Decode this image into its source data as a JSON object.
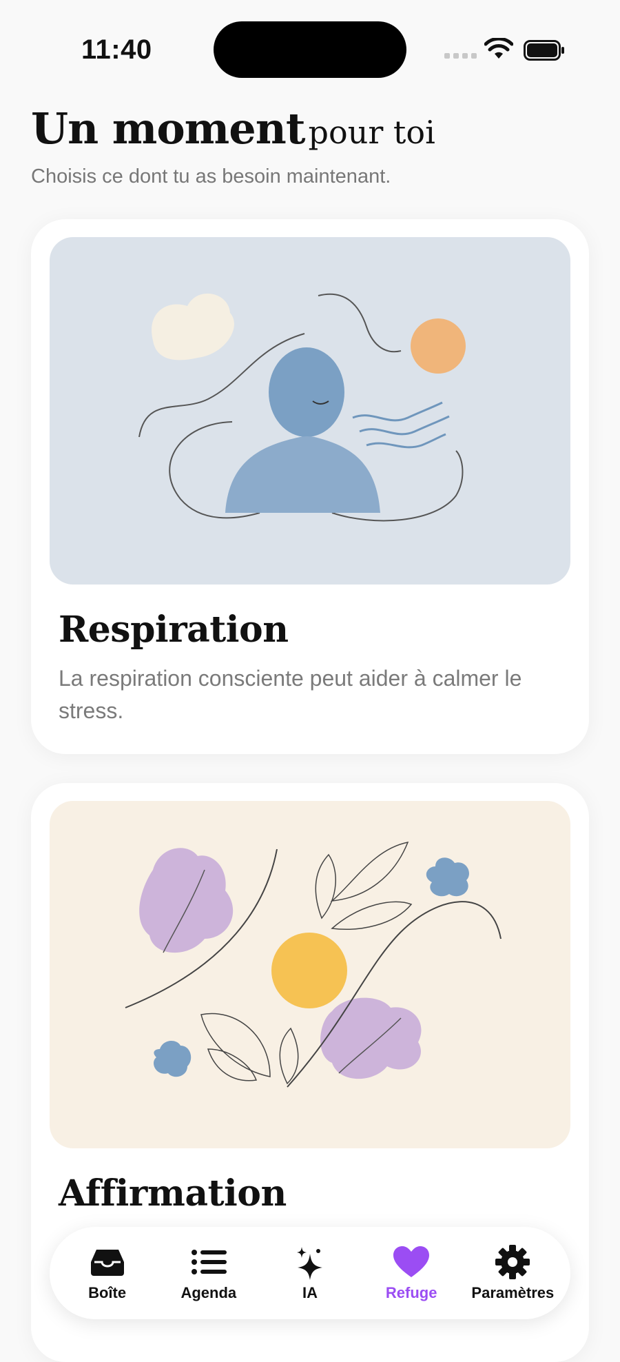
{
  "status_bar": {
    "time": "11:40"
  },
  "header": {
    "title_bold": "Un moment",
    "title_light": "pour toi",
    "subtitle": "Choisis ce dont tu as besoin maintenant."
  },
  "cards": [
    {
      "title": "Respiration",
      "description": "La respiration consciente peut aider à calmer le stress.",
      "illustration": "breathing-figure-illustration"
    },
    {
      "title": "Affirmation",
      "description": "",
      "illustration": "leaves-and-sun-illustration"
    }
  ],
  "tab_bar": {
    "active_color": "#9b4df3",
    "tabs": [
      {
        "label": "Boîte",
        "icon": "inbox-tray-icon"
      },
      {
        "label": "Agenda",
        "icon": "list-icon"
      },
      {
        "label": "IA",
        "icon": "sparkles-icon"
      },
      {
        "label": "Refuge",
        "icon": "heart-icon",
        "active": true
      },
      {
        "label": "Paramètres",
        "icon": "gear-icon"
      }
    ]
  }
}
